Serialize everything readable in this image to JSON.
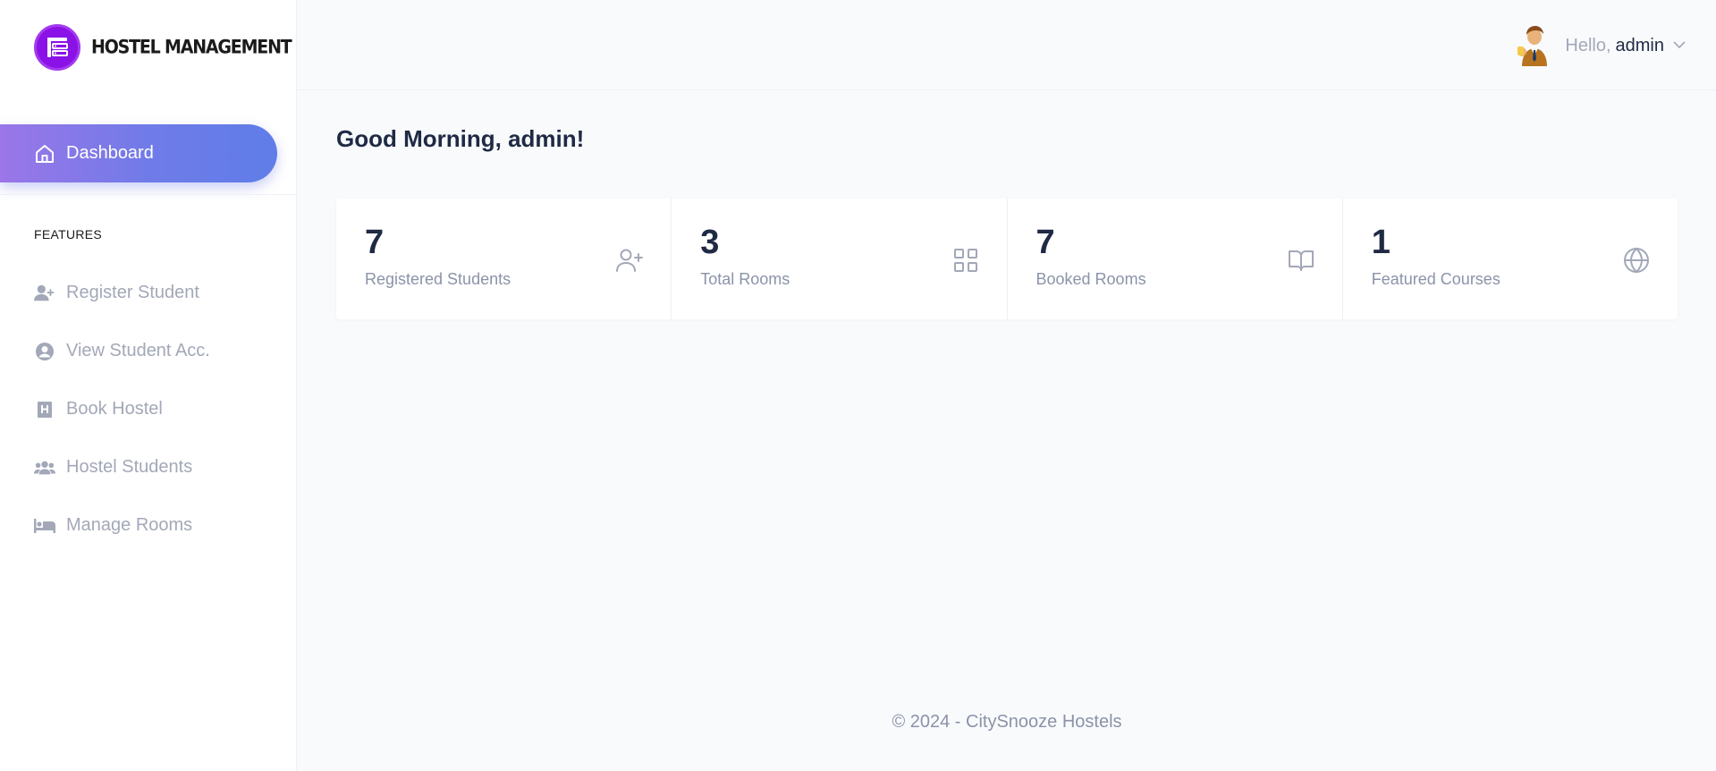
{
  "brand": {
    "name": "HOSTEL MANAGEMENT",
    "logo_color": "#8a12e6"
  },
  "sidebar": {
    "dashboard": {
      "label": "Dashboard",
      "icon": "home-icon"
    },
    "section_label": "FEATURES",
    "items": [
      {
        "label": "Register Student",
        "icon": "user-plus-icon"
      },
      {
        "label": "View Student Acc.",
        "icon": "user-circle-icon"
      },
      {
        "label": "Book Hostel",
        "icon": "hotel-icon"
      },
      {
        "label": "Hostel Students",
        "icon": "users-icon"
      },
      {
        "label": "Manage Rooms",
        "icon": "bed-icon"
      }
    ]
  },
  "header": {
    "greeting_prefix": "Hello,",
    "username": "admin"
  },
  "main": {
    "greeting": "Good Morning, admin!",
    "stats": [
      {
        "value": "7",
        "label": "Registered Students",
        "icon": "user-plus-icon"
      },
      {
        "value": "3",
        "label": "Total Rooms",
        "icon": "grid-icon"
      },
      {
        "value": "7",
        "label": "Booked Rooms",
        "icon": "book-open-icon"
      },
      {
        "value": "1",
        "label": "Featured Courses",
        "icon": "globe-icon"
      }
    ]
  },
  "footer": {
    "text": "© 2024 - CitySnooze Hostels"
  },
  "colors": {
    "accent_start": "#9b76e8",
    "accent_end": "#5f7de8",
    "muted": "#a3a8b8",
    "text": "#1f2a44"
  }
}
